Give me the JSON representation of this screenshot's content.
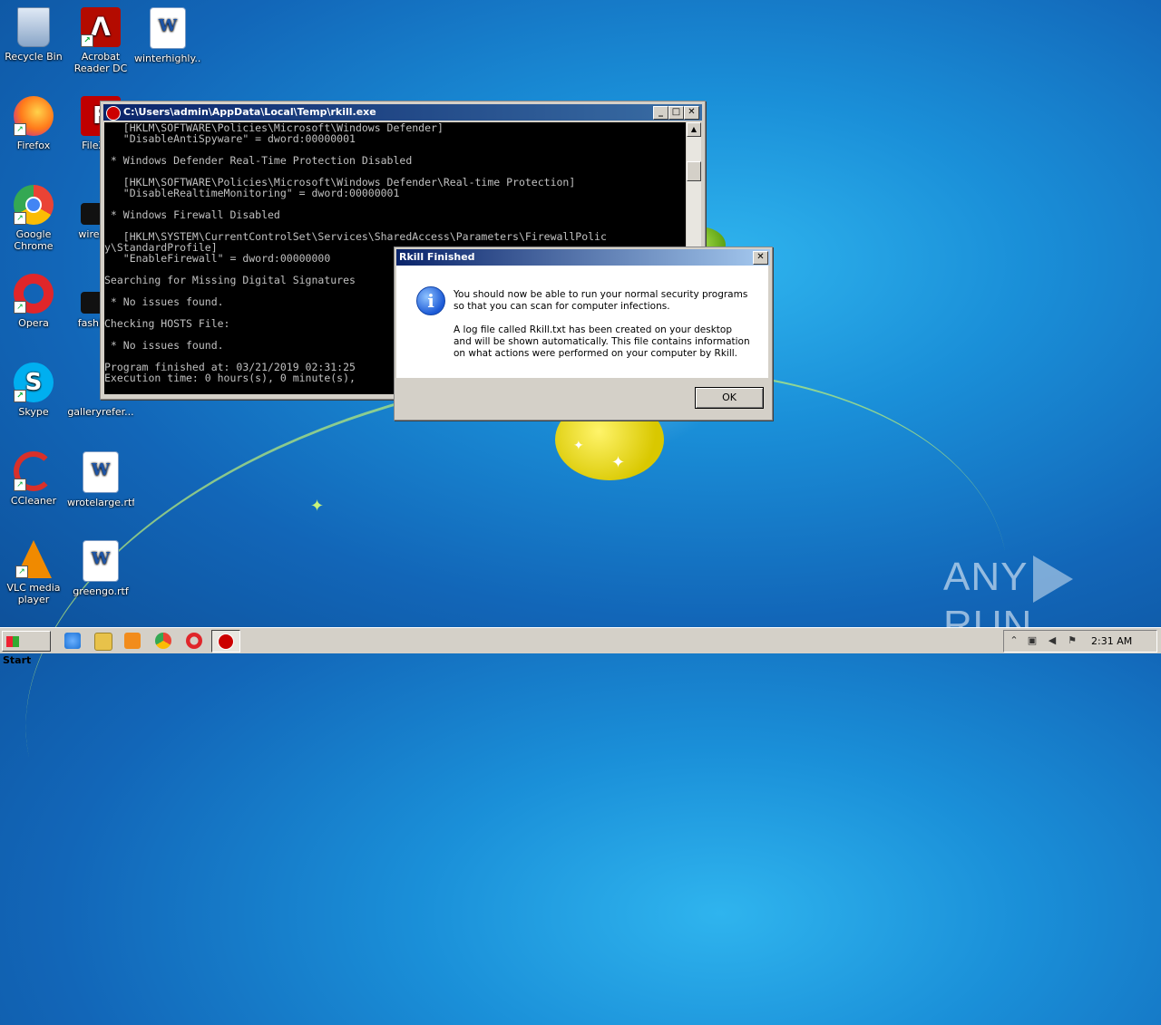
{
  "desktop": {
    "icons": [
      {
        "label": "Recycle Bin",
        "icon": "recycle-bin-icon",
        "color": "#9fb7d8"
      },
      {
        "label": "Acrobat Reader DC",
        "icon": "acrobat-icon",
        "color": "#b30b00"
      },
      {
        "label": "winterhighly...",
        "icon": "word-doc-icon",
        "color": "#ffffff"
      },
      {
        "label": "Firefox",
        "icon": "firefox-icon",
        "color": "#ff7a1a"
      },
      {
        "label": "FileZilla",
        "icon": "filezilla-icon",
        "color": "#bf0000"
      },
      {
        "label": "Google Chrome",
        "icon": "chrome-icon",
        "color": "#34a853"
      },
      {
        "label": "wireles...",
        "icon": "file-icon",
        "color": "#111111"
      },
      {
        "label": "Opera",
        "icon": "opera-icon",
        "color": "#e0262a"
      },
      {
        "label": "fashion...",
        "icon": "file-icon",
        "color": "#111111"
      },
      {
        "label": "Skype",
        "icon": "skype-icon",
        "color": "#00aff0"
      },
      {
        "label": "galleryrefer...",
        "icon": "file-icon",
        "color": "#dddddd"
      },
      {
        "label": "CCleaner",
        "icon": "ccleaner-icon",
        "color": "#d8302a"
      },
      {
        "label": "wrotelarge.rtf",
        "icon": "word-doc-icon",
        "color": "#ffffff"
      },
      {
        "label": "VLC media player",
        "icon": "vlc-icon",
        "color": "#f08a00"
      },
      {
        "label": "greengo.rtf",
        "icon": "word-doc-icon",
        "color": "#ffffff"
      }
    ]
  },
  "console": {
    "title": "C:\\Users\\admin\\AppData\\Local\\Temp\\rkill.exe",
    "lines": [
      "   [HKLM\\SOFTWARE\\Policies\\Microsoft\\Windows Defender]",
      "   \"DisableAntiSpyware\" = dword:00000001",
      "",
      " * Windows Defender Real-Time Protection Disabled",
      "",
      "   [HKLM\\SOFTWARE\\Policies\\Microsoft\\Windows Defender\\Real-time Protection]",
      "   \"DisableRealtimeMonitoring\" = dword:00000001",
      "",
      " * Windows Firewall Disabled",
      "",
      "   [HKLM\\SYSTEM\\CurrentControlSet\\Services\\SharedAccess\\Parameters\\FirewallPolic",
      "y\\StandardProfile]",
      "   \"EnableFirewall\" = dword:00000000",
      "",
      "Searching for Missing Digital Signatures",
      "",
      " * No issues found.",
      "",
      "Checking HOSTS File:",
      "",
      " * No issues found.",
      "",
      "Program finished at: 03/21/2019 02:31:25",
      "Execution time: 0 hours(s), 0 minute(s),"
    ]
  },
  "dialog": {
    "title": "Rkill Finished",
    "paragraph1": "You should now be able to run your normal security programs so that you can scan for computer infections.",
    "paragraph2": "A log file called Rkill.txt has been created on your desktop and will be shown automatically.  This file contains information on what actions were performed on your computer by Rkill.",
    "ok_label": "OK"
  },
  "watermark": {
    "left": "ANY",
    "right": "RUN"
  },
  "taskbar": {
    "start_label": "Start",
    "clock": "2:31 AM",
    "quick_launch": [
      {
        "icon": "internet-explorer-icon",
        "color": "#1e73d6"
      },
      {
        "icon": "explorer-folder-icon",
        "color": "#e8c24a"
      },
      {
        "icon": "media-player-icon",
        "color": "#f28c1c"
      },
      {
        "icon": "chrome-icon",
        "color": "#34a853"
      },
      {
        "icon": "opera-icon",
        "color": "#e0262a"
      }
    ],
    "active_task_icon": "rkill-icon"
  }
}
